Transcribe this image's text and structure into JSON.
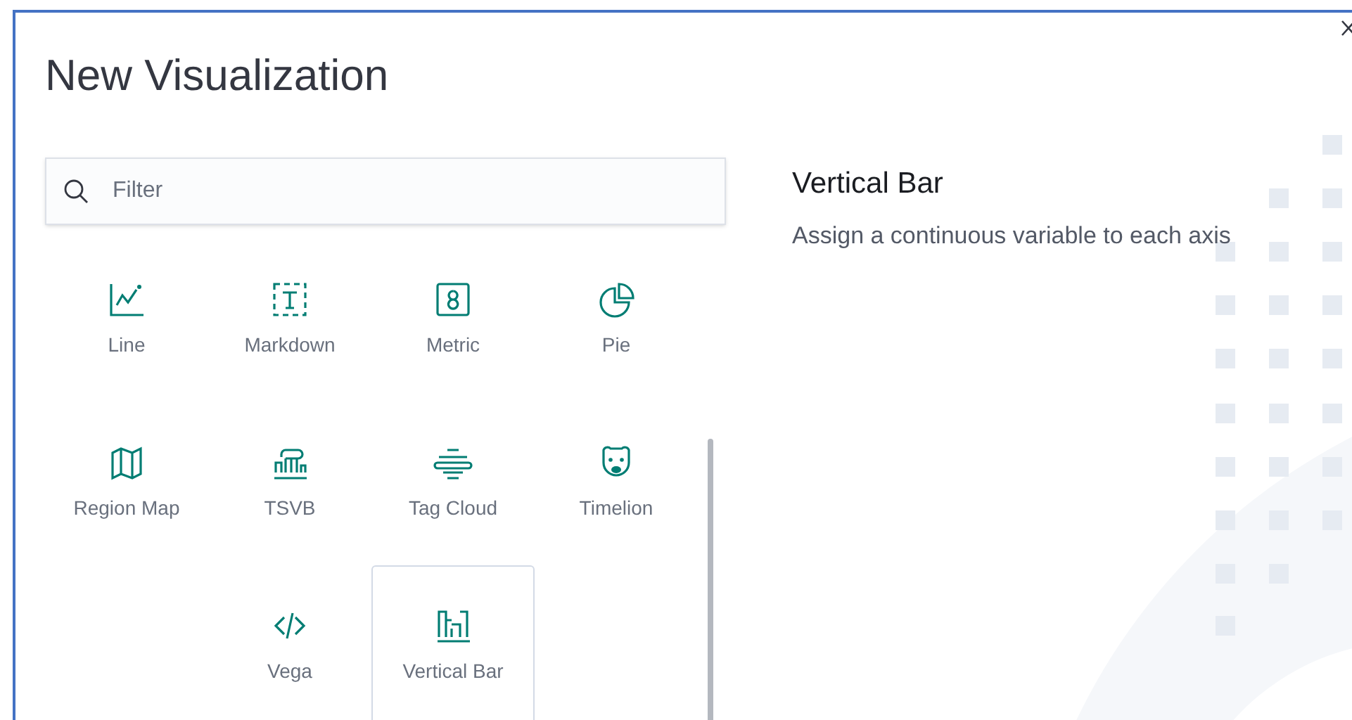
{
  "dialog": {
    "title": "New Visualization"
  },
  "search": {
    "placeholder": "Filter"
  },
  "items": [
    {
      "label": "Line",
      "selected": false
    },
    {
      "label": "Markdown",
      "selected": false
    },
    {
      "label": "Metric",
      "selected": false
    },
    {
      "label": "Pie",
      "selected": false
    },
    {
      "label": "Region Map",
      "selected": false
    },
    {
      "label": "TSVB",
      "selected": false
    },
    {
      "label": "Tag Cloud",
      "selected": false
    },
    {
      "label": "Timelion",
      "selected": false
    },
    {
      "label": "Vega",
      "selected": false
    },
    {
      "label": "Vertical Bar",
      "selected": true
    }
  ],
  "preview": {
    "title": "Vertical Bar",
    "description": "Assign a continuous variable to each axis"
  }
}
